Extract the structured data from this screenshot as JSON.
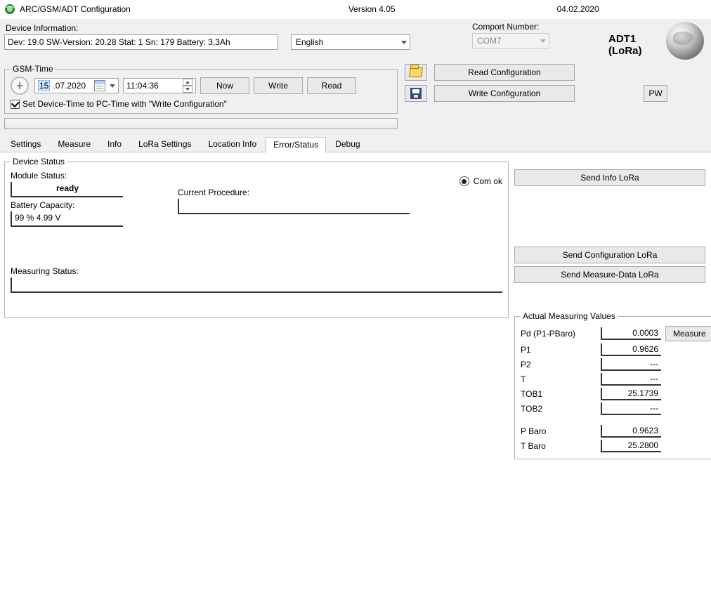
{
  "titlebar": {
    "title": "ARC/GSM/ADT Configuration",
    "version": "Version 4.05",
    "date": "04.02.2020"
  },
  "devinfo": {
    "label": "Device Information:",
    "value": "Dev: 19.0 SW-Version: 20.28 Stat: 1 Sn: 179 Battery: 3,3Ah"
  },
  "language": {
    "selected": "English"
  },
  "comport": {
    "label": "Comport Number:",
    "selected": "COM7"
  },
  "device_name": "ADT1 (LoRa)",
  "gsm_time": {
    "legend": "GSM-Time",
    "date_day": "15",
    "date_rest": ".07.2020",
    "time": "11:04:36",
    "now": "Now",
    "write": "Write",
    "read": "Read",
    "set_pc_time": "Set Device-Time to PC-Time with \"Write Configuration\""
  },
  "buttons": {
    "read_cfg": "Read Configuration",
    "write_cfg": "Write Configuration",
    "pw": "PW"
  },
  "tabs": {
    "settings": "Settings",
    "measure": "Measure",
    "info": "Info",
    "lora": "LoRa Settings",
    "location": "Location Info",
    "error_status": "Error/Status",
    "debug": "Debug"
  },
  "device_status": {
    "legend": "Device Status",
    "module_status_label": "Module Status:",
    "module_status_value": "ready",
    "battery_label": "Battery Capacity:",
    "battery_value": "99 %   4.99 V",
    "current_procedure_label": "Current Procedure:",
    "com_ok": "Com ok",
    "measuring_status_label": "Measuring Status:"
  },
  "side": {
    "send_info": "Send Info LoRa",
    "send_cfg": "Send Configuration LoRa",
    "send_measure": "Send Measure-Data LoRa"
  },
  "amv": {
    "legend": "Actual Measuring Values",
    "measure_btn": "Measure",
    "rows": [
      {
        "lbl": "Pd (P1-PBaro)",
        "val": "0.0003"
      },
      {
        "lbl": "P1",
        "val": "0.9626"
      },
      {
        "lbl": "P2",
        "val": "---"
      },
      {
        "lbl": "T",
        "val": "---"
      },
      {
        "lbl": "TOB1",
        "val": "25.1739"
      },
      {
        "lbl": "TOB2",
        "val": "---"
      }
    ],
    "rows2": [
      {
        "lbl": "P Baro",
        "val": "0.9623"
      },
      {
        "lbl": "T Baro",
        "val": "25.2800"
      }
    ]
  }
}
